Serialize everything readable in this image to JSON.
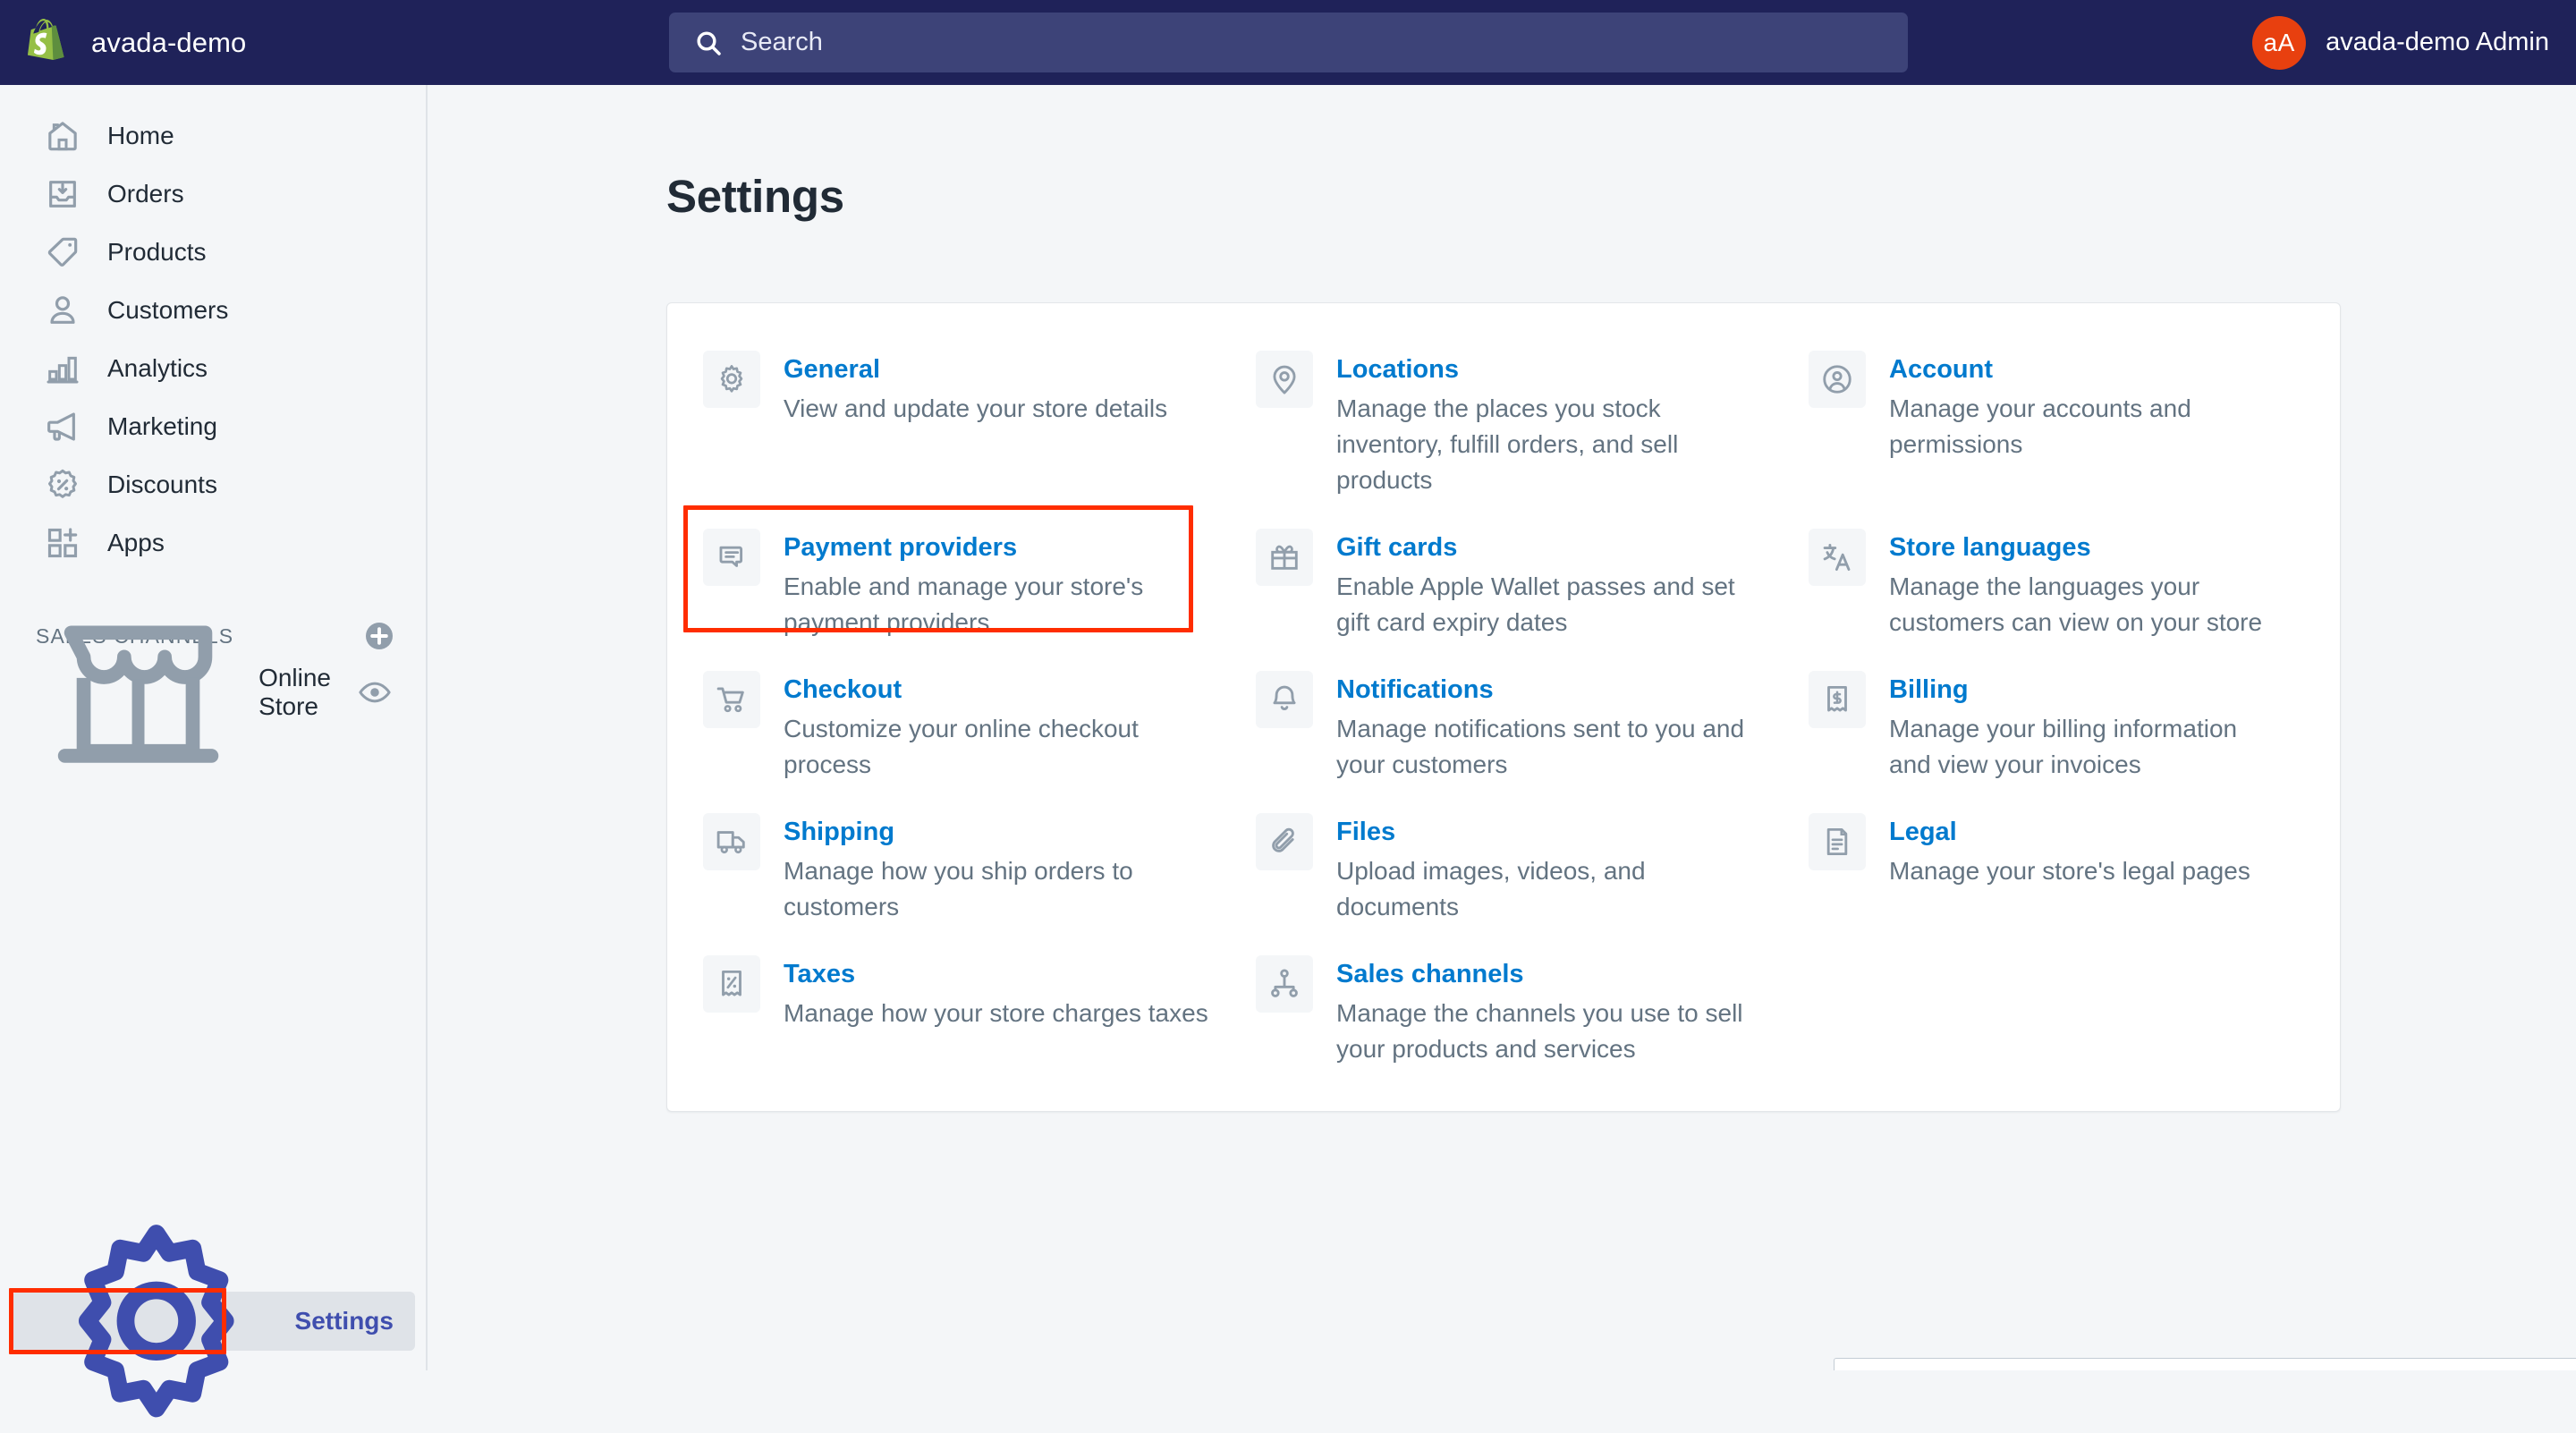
{
  "topbar": {
    "store_name": "avada-demo",
    "logo_icon": "shopify-bag-icon",
    "search": {
      "placeholder": "Search",
      "icon": "search-icon",
      "value": ""
    },
    "user": {
      "initials": "aA",
      "name": "avada-demo Admin",
      "avatar_color": "#E8400F"
    }
  },
  "sidebar": {
    "nav": [
      {
        "label": "Home",
        "icon": "home-icon"
      },
      {
        "label": "Orders",
        "icon": "orders-inbox-icon"
      },
      {
        "label": "Products",
        "icon": "product-tag-icon"
      },
      {
        "label": "Customers",
        "icon": "customer-person-icon"
      },
      {
        "label": "Analytics",
        "icon": "analytics-bars-icon"
      },
      {
        "label": "Marketing",
        "icon": "marketing-megaphone-icon"
      },
      {
        "label": "Discounts",
        "icon": "discount-percent-icon"
      },
      {
        "label": "Apps",
        "icon": "apps-grid-plus-icon"
      }
    ],
    "sales_channels": {
      "title": "SALES CHANNELS",
      "add_icon": "plus-circle-icon",
      "items": [
        {
          "label": "Online Store",
          "icon": "online-store-icon",
          "action_icon": "eye-icon"
        }
      ]
    },
    "settings": {
      "label": "Settings",
      "icon": "gear-icon"
    }
  },
  "main": {
    "title": "Settings",
    "settings_items": [
      {
        "label": "General",
        "description": "View and update your store details",
        "icon": "gear-icon",
        "highlighted": false
      },
      {
        "label": "Locations",
        "description": "Manage the places you stock inventory, fulfill orders, and sell products",
        "icon": "location-pin-icon",
        "highlighted": false
      },
      {
        "label": "Account",
        "description": "Manage your accounts and permissions",
        "icon": "account-circle-icon",
        "highlighted": false
      },
      {
        "label": "Payment providers",
        "description": "Enable and manage your store's payment providers",
        "icon": "payment-card-icon",
        "highlighted": true
      },
      {
        "label": "Gift cards",
        "description": "Enable Apple Wallet passes and set gift card expiry dates",
        "icon": "gift-card-icon",
        "highlighted": false
      },
      {
        "label": "Store languages",
        "description": "Manage the languages your customers can view on your store",
        "icon": "language-translate-icon",
        "highlighted": false
      },
      {
        "label": "Checkout",
        "description": "Customize your online checkout process",
        "icon": "shopping-cart-icon",
        "highlighted": false
      },
      {
        "label": "Notifications",
        "description": "Manage notifications sent to you and your customers",
        "icon": "bell-icon",
        "highlighted": false
      },
      {
        "label": "Billing",
        "description": "Manage your billing information and view your invoices",
        "icon": "billing-receipt-icon",
        "highlighted": false
      },
      {
        "label": "Shipping",
        "description": "Manage how you ship orders to customers",
        "icon": "shipping-truck-icon",
        "highlighted": false
      },
      {
        "label": "Files",
        "description": "Upload images, videos, and documents",
        "icon": "paperclip-icon",
        "highlighted": false
      },
      {
        "label": "Legal",
        "description": "Manage your store's legal pages",
        "icon": "legal-document-icon",
        "highlighted": false
      },
      {
        "label": "Taxes",
        "description": "Manage how your store charges taxes",
        "icon": "tax-receipt-percent-icon",
        "highlighted": false
      },
      {
        "label": "Sales channels",
        "description": "Manage the channels you use to sell your products and services",
        "icon": "sales-channels-node-icon",
        "highlighted": false
      }
    ]
  },
  "annotations": {
    "color": "#FF2D00",
    "targets": [
      "payment-providers-setting",
      "sidebar-settings-item"
    ]
  }
}
